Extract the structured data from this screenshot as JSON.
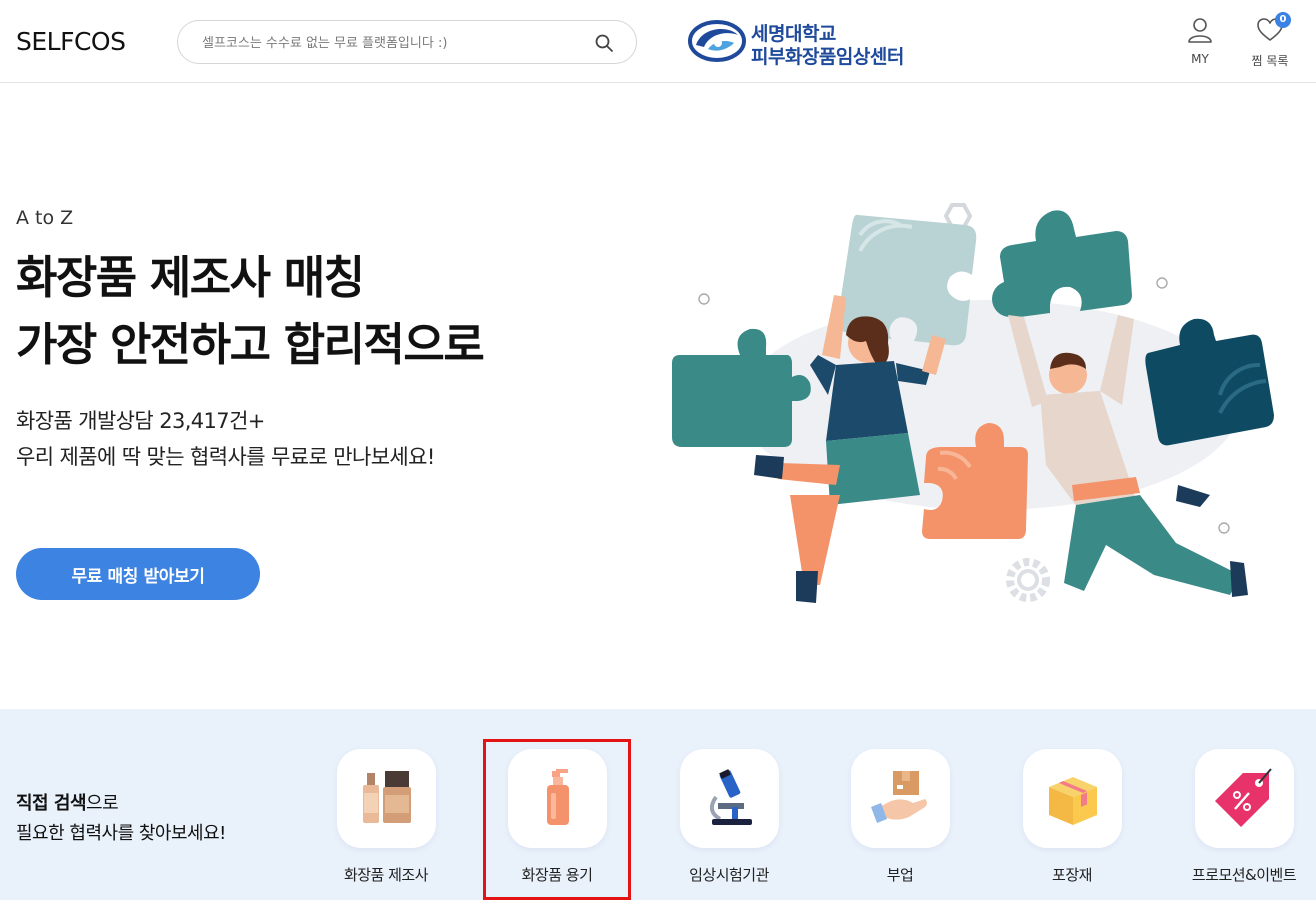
{
  "header": {
    "logo": "SELFCOS",
    "search_placeholder": "셀프코스는 수수료 없는 무료 플랫폼입니다 :)",
    "partner": {
      "line1": "세명대학교",
      "line2": "피부화장품임상센터"
    },
    "my_label": "MY",
    "wishlist_label": "찜 목록",
    "wishlist_count": "0"
  },
  "hero": {
    "eyebrow": "A to Z",
    "title_line1": "화장품 제조사 매칭",
    "title_line2": "가장 안전하고 합리적으로",
    "sub_line1": "화장품 개발상담 23,417건+",
    "sub_line2": "우리 제품에 딱 맞는 협력사를 무료로 만나보세요!",
    "cta": "무료 매칭 받아보기"
  },
  "direct_search": {
    "bold": "직접 검색",
    "rest": "으로",
    "line2": "필요한 협력사를 찾아보세요!"
  },
  "categories": [
    {
      "label": "화장품 제조사",
      "icon": "cosmetic-bottles-icon"
    },
    {
      "label": "화장품 용기",
      "icon": "pump-bottle-icon"
    },
    {
      "label": "임상시험기관",
      "icon": "microscope-icon"
    },
    {
      "label": "부업",
      "icon": "hand-box-icon"
    },
    {
      "label": "포장재",
      "icon": "package-box-icon"
    },
    {
      "label": "프로모션&이벤트",
      "icon": "discount-tag-icon"
    }
  ],
  "colors": {
    "accent": "#3d83e1",
    "band_bg": "#e9f1fb",
    "partner_blue": "#1f4a9c",
    "highlight": "#e51414"
  }
}
